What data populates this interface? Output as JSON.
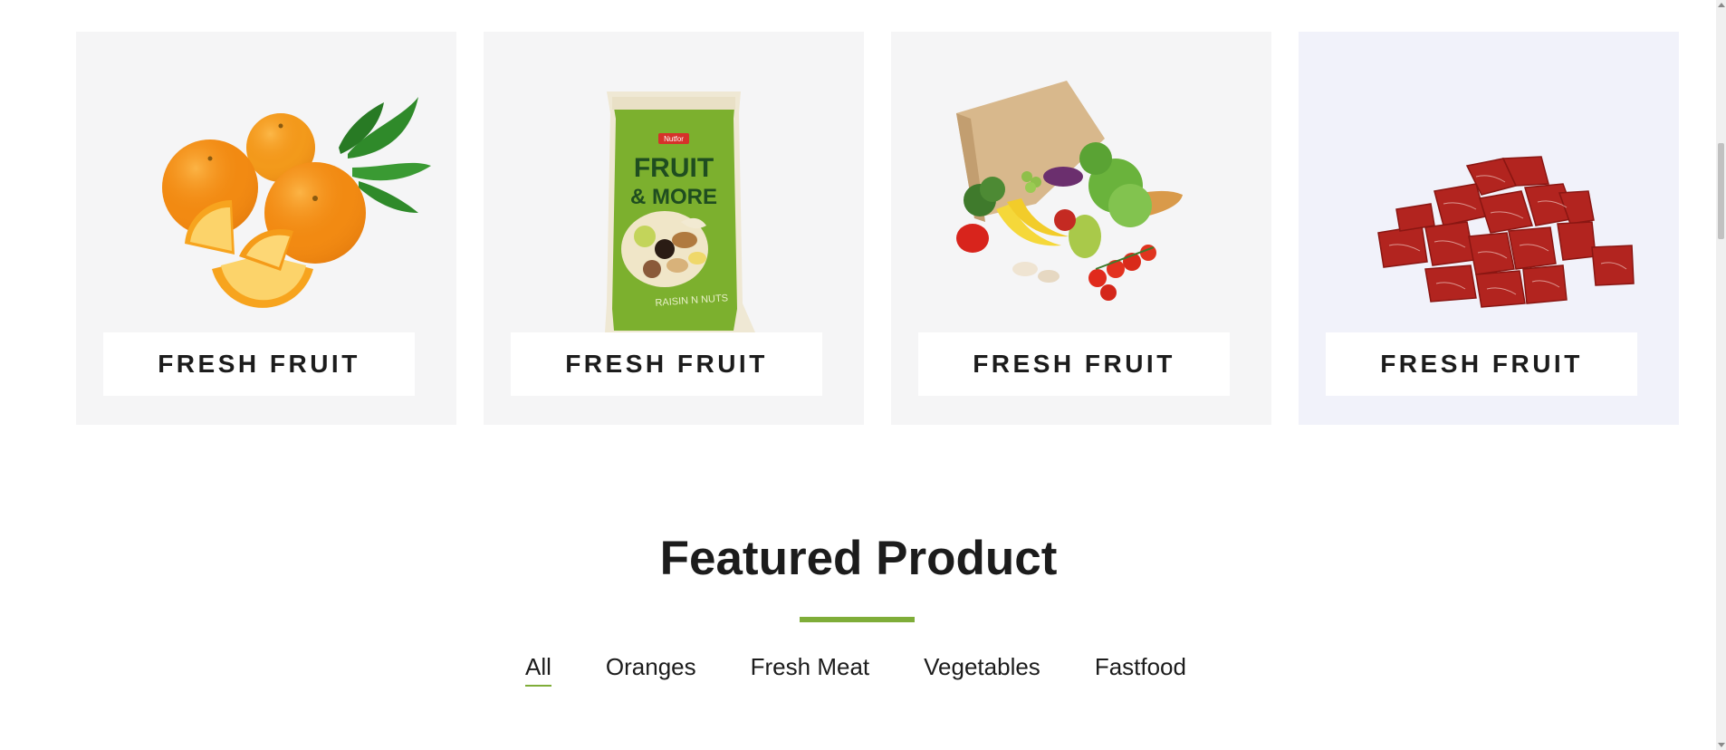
{
  "categories": [
    {
      "label": "FRESH FRUIT",
      "image": "oranges"
    },
    {
      "label": "FRESH FRUIT",
      "image": "fruit-and-more-snack-bag"
    },
    {
      "label": "FRESH FRUIT",
      "image": "grocery-bag-vegetables"
    },
    {
      "label": "FRESH FRUIT",
      "image": "raw-beef-cubes"
    }
  ],
  "snack_bag": {
    "brand": "Nutfor",
    "line1": "FRUIT",
    "line2": "& MORE",
    "tagline": "RAISIN N NUTS"
  },
  "featured": {
    "title": "Featured Product",
    "accent_color": "#7fad39",
    "filters": [
      {
        "label": "All",
        "active": true
      },
      {
        "label": "Oranges",
        "active": false
      },
      {
        "label": "Fresh Meat",
        "active": false
      },
      {
        "label": "Vegetables",
        "active": false
      },
      {
        "label": "Fastfood",
        "active": false
      }
    ]
  }
}
